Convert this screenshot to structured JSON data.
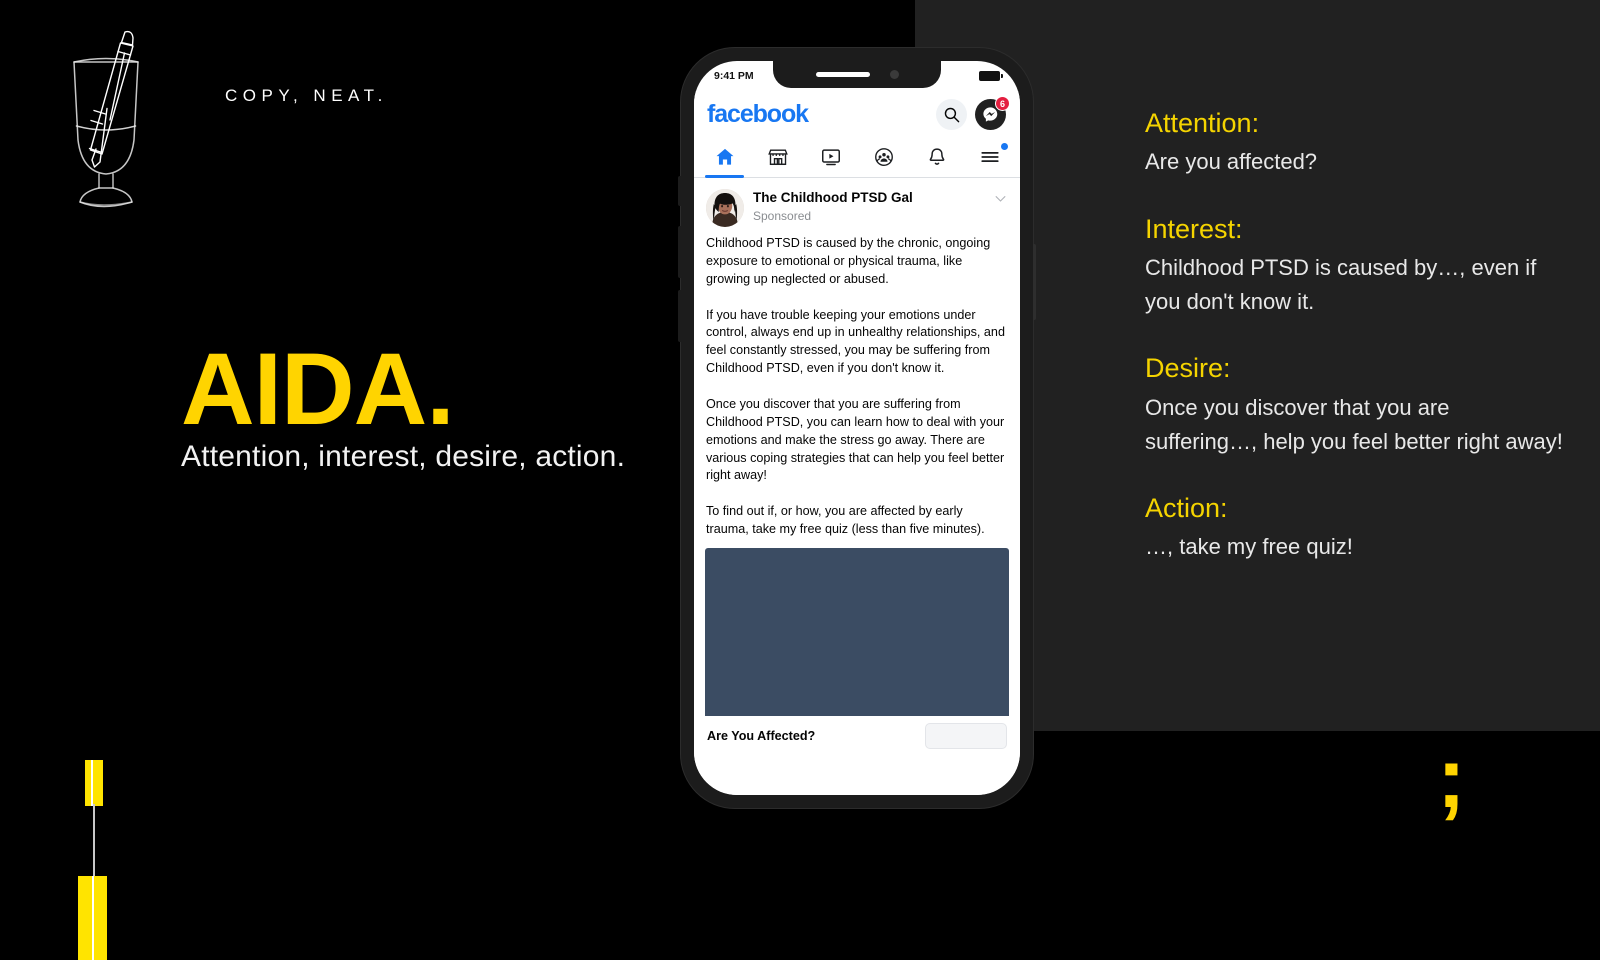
{
  "brand": {
    "wordmark": "COPY, NEAT.",
    "logo_icon": "whisky-glass-with-pen-icon",
    "accent_color": "#FFD400",
    "background_color": "#000000",
    "panel_color": "#212121"
  },
  "hero": {
    "title": "AIDA.",
    "subtitle": "Attention, interest, desire, action."
  },
  "decor": {
    "highlighter_icon": "yellow-highlighter-pen-icon",
    "semicolon_glyph": ";"
  },
  "copy_breakdown": [
    {
      "heading": "Attention:",
      "body": "Are you affected?"
    },
    {
      "heading": "Interest:",
      "body": "Childhood PTSD is caused by…, even if you don't know it."
    },
    {
      "heading": "Desire:",
      "body": "Once you discover that you are suffering…, help you feel better right away!"
    },
    {
      "heading": "Action:",
      "body": "…, take my free quiz!"
    }
  ],
  "phone": {
    "status_bar": {
      "time": "9:41 PM",
      "battery_icon": "battery-full-icon"
    },
    "app": {
      "logo_text": "facebook",
      "logo_color": "#1877F2",
      "actions": [
        {
          "name": "search-icon",
          "label": "Search"
        },
        {
          "name": "messenger-icon",
          "label": "Messenger",
          "badge": "6",
          "badge_color": "#E41E3F"
        }
      ],
      "nav_tabs": [
        {
          "icon": "home-icon",
          "label": "Home",
          "active": true
        },
        {
          "icon": "marketplace-icon",
          "label": "Marketplace",
          "active": false
        },
        {
          "icon": "video-icon",
          "label": "Watch",
          "active": false
        },
        {
          "icon": "groups-icon",
          "label": "Groups",
          "active": false
        },
        {
          "icon": "bell-icon",
          "label": "Notifications",
          "active": false
        },
        {
          "icon": "menu-icon",
          "label": "Menu",
          "active": false,
          "dot": true
        }
      ]
    },
    "post": {
      "author": "The Childhood PTSD Gal",
      "sponsored_label": "Sponsored",
      "menu_icon": "chevron-down-icon",
      "body": "Childhood PTSD is caused by the chronic, ongoing exposure to emotional or physical trauma, like growing up neglected or abused.\n\nIf you have trouble keeping your emotions under control, always end up in unhealthy relationships, and feel constantly stressed, you may be suffering from Childhood PTSD, even if you don't know it.\n\nOnce you discover that you are suffering from Childhood PTSD, you can learn how to deal with your emotions and make the stress go away. There are various coping strategies that can help you feel better right away!\n\nTo find out if, or how, you are affected by early trauma, take my free quiz (less than five minutes).",
      "image_color": "#3B4C63",
      "link_title": "Are You Affected?",
      "cta_button_label": ""
    }
  }
}
